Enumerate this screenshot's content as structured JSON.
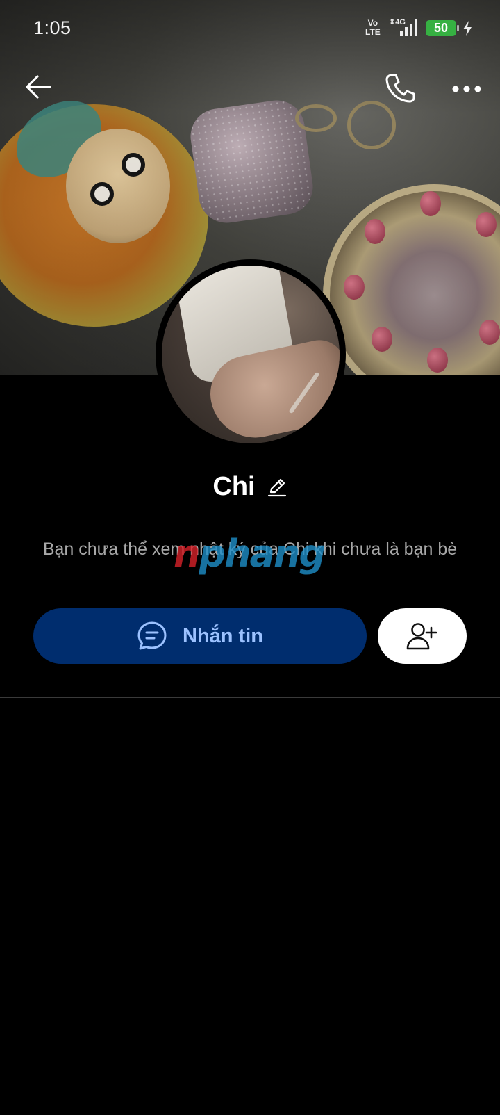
{
  "status_bar": {
    "time": "1:05",
    "network_volte_top": "Vo",
    "network_volte_bottom": "LTE",
    "network_type": "4G",
    "battery_level": "50",
    "battery_color": "#36b042"
  },
  "header": {
    "back_icon": "arrow-left-icon",
    "call_icon": "phone-icon",
    "more_icon": "more-horizontal-icon"
  },
  "profile": {
    "name": "Chi",
    "edit_icon": "pencil-icon",
    "diary_notice": "Bạn chưa thể xem nhật ký của Chi khi chưa là bạn bè"
  },
  "watermark": {
    "part_a": "n",
    "part_b": "phang"
  },
  "actions": {
    "message_label": "Nhắn tin",
    "message_icon": "chat-bubble-icon",
    "add_friend_icon": "add-user-icon",
    "message_button_color": "#002d6e",
    "message_text_color": "#9cc2ff"
  }
}
